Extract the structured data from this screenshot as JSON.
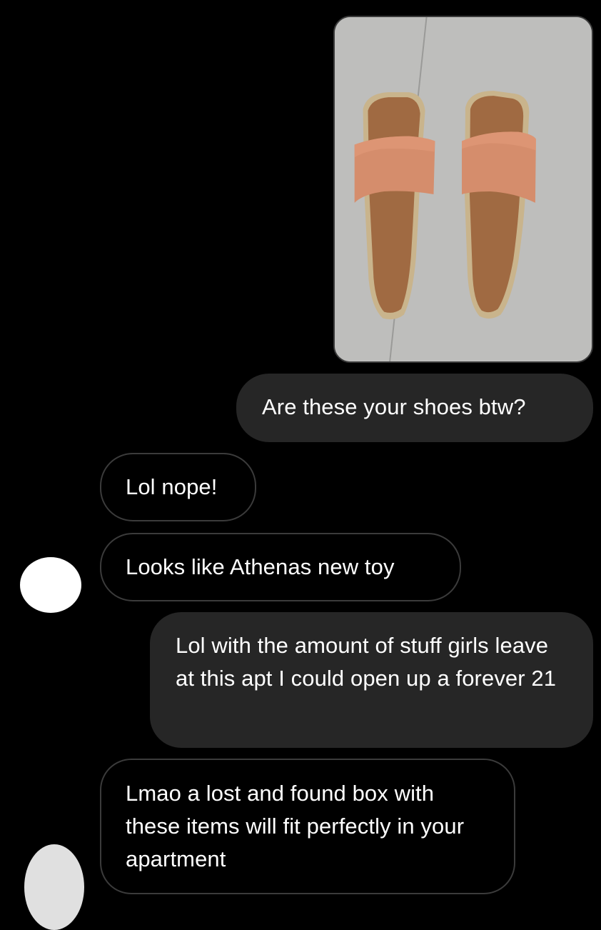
{
  "conversation": {
    "photo_message": {
      "icon": "sandals-photo",
      "subject_colors": {
        "floor": "#b9b9b7",
        "strap": "#d58d6c",
        "footbed": "#a06a42",
        "rope_sole": "#c9b48c"
      }
    },
    "messages": [
      {
        "sender": "me",
        "text": "Are these your shoes btw?"
      },
      {
        "sender": "them",
        "text": "Lol nope!"
      },
      {
        "sender": "them",
        "text": "Looks like Athenas new toy"
      },
      {
        "sender": "me",
        "text": "Lol with the amount of stuff girls leave at this apt I could open up a forever 21"
      },
      {
        "sender": "them",
        "text": "Lmao a lost and found box with these items will fit perfectly in your apartment"
      }
    ]
  },
  "colors": {
    "background": "#000000",
    "outgoing_bubble": "#262626",
    "incoming_border": "#3b3b3b",
    "text": "#ffffff"
  }
}
